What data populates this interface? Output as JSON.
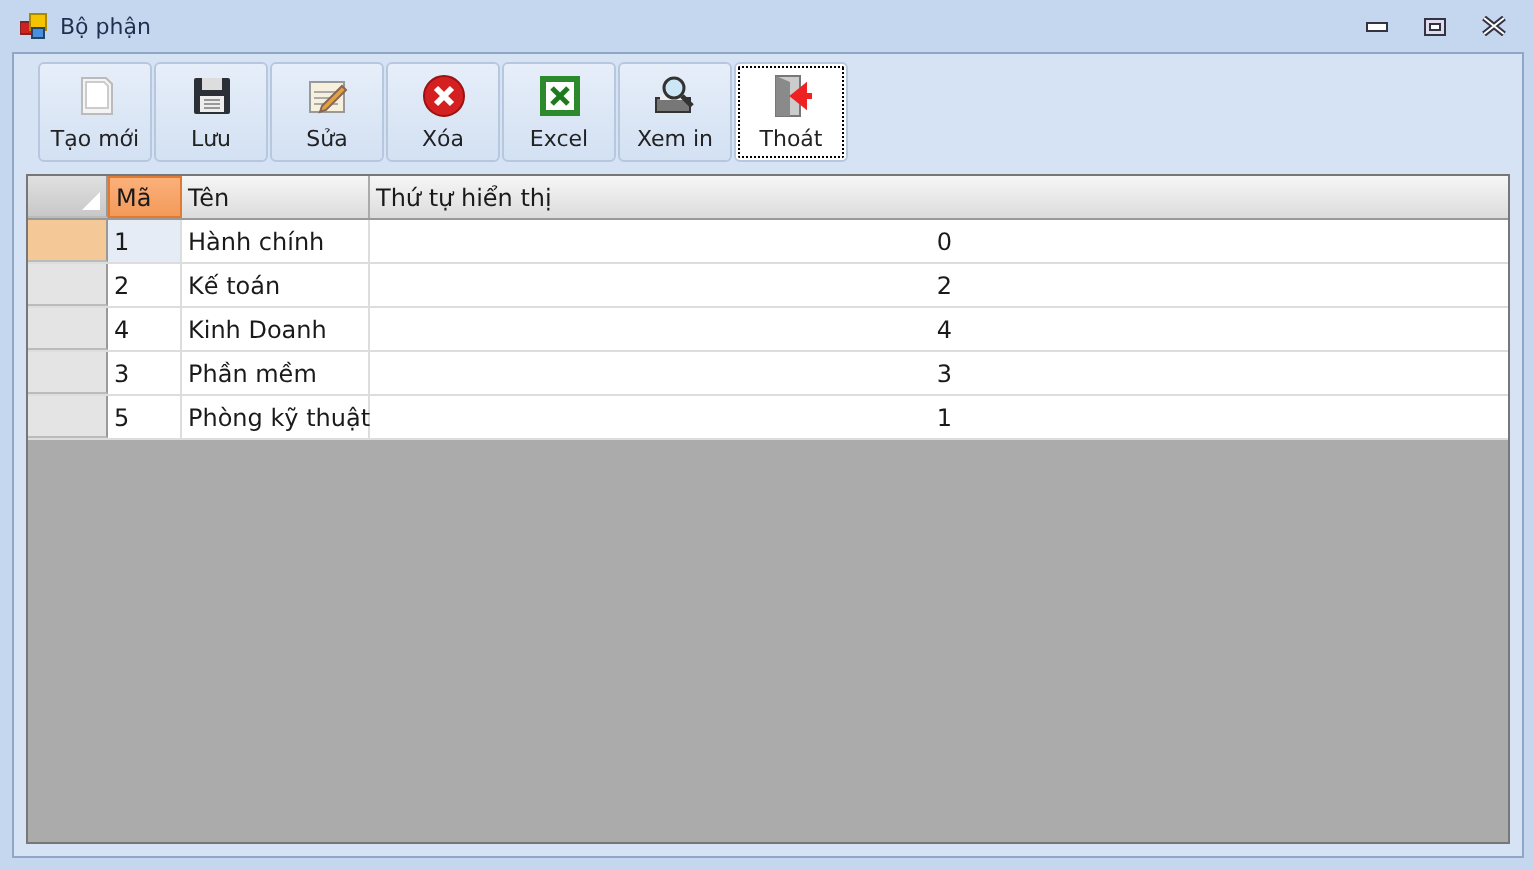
{
  "window": {
    "title": "Bộ phận"
  },
  "toolbar": [
    {
      "label": "Tạo mới",
      "kind": "new",
      "focused": false
    },
    {
      "label": "Lưu",
      "kind": "save",
      "focused": false
    },
    {
      "label": "Sửa",
      "kind": "edit",
      "focused": false
    },
    {
      "label": "Xóa",
      "kind": "delete",
      "focused": false
    },
    {
      "label": "Excel",
      "kind": "excel",
      "focused": false
    },
    {
      "label": "Xem in",
      "kind": "preview",
      "focused": false
    },
    {
      "label": "Thoát",
      "kind": "exit",
      "focused": true
    }
  ],
  "table": {
    "columns": [
      {
        "label": "Mã",
        "selected": true
      },
      {
        "label": "Tên",
        "selected": false
      },
      {
        "label": "Thứ tự hiển thị",
        "selected": false
      }
    ],
    "rows": [
      {
        "cells": [
          "1",
          "Hành chính",
          "0"
        ],
        "selected": true
      },
      {
        "cells": [
          "2",
          "Kế toán",
          "2"
        ],
        "selected": false
      },
      {
        "cells": [
          "4",
          "Kinh Doanh",
          "4"
        ],
        "selected": false
      },
      {
        "cells": [
          "3",
          "Phần mềm",
          "3"
        ],
        "selected": false
      },
      {
        "cells": [
          "5",
          "Phòng kỹ thuật",
          "1"
        ],
        "selected": false
      }
    ]
  }
}
